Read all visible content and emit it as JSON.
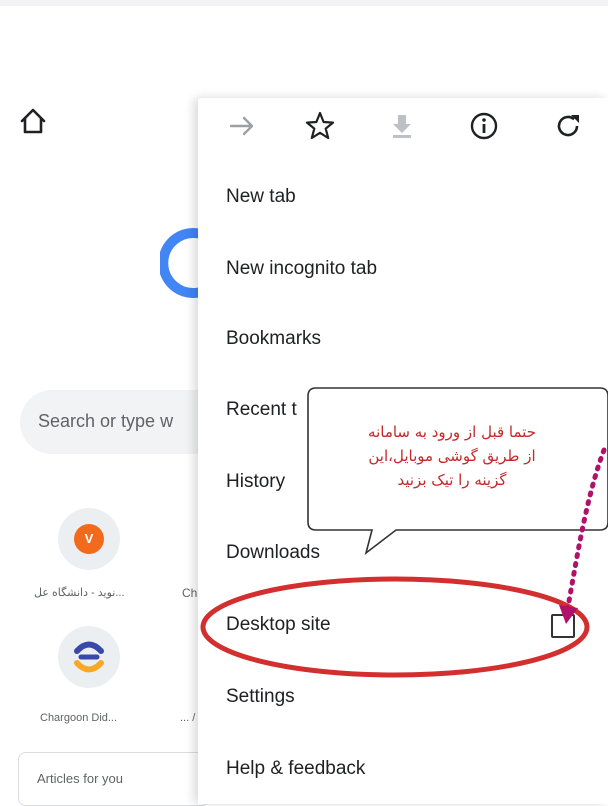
{
  "background_page": {
    "search_placeholder": "Search or type w",
    "tiles": [
      {
        "letter": "V",
        "label": "نوید - دانشگاه عل..."
      },
      {
        "label": "Ch"
      },
      {
        "label": "Chargoon Did..."
      },
      {
        "label": "... /"
      }
    ],
    "articles_label": "Articles for you"
  },
  "menu": {
    "toolbar_icons": [
      "forward-icon",
      "star-icon",
      "download-icon",
      "info-icon",
      "refresh-icon"
    ],
    "items": [
      {
        "label": "New tab"
      },
      {
        "label": "New incognito tab"
      },
      {
        "label": "Bookmarks"
      },
      {
        "label": "Recent tabs",
        "visible_label": "Recent t"
      },
      {
        "label": "History"
      },
      {
        "label": "Downloads"
      },
      {
        "label": "Desktop site",
        "checked": false
      },
      {
        "label": "Settings"
      },
      {
        "label": "Help & feedback"
      }
    ]
  },
  "annotation": {
    "callout_lines": [
      "حتما قبل از ورود به سامانه",
      "از طریق گوشی موبایل،این",
      "گزینه را تیک بزنید"
    ],
    "highlight_color": "#d32f2f",
    "text_color": "#c62828",
    "arrow_color": "#b0126a"
  },
  "colors": {
    "google_blue": "#4285f4",
    "orange_avatar": "#f26b1d",
    "menu_text": "#202124",
    "icon_gray": "#5f6368"
  }
}
